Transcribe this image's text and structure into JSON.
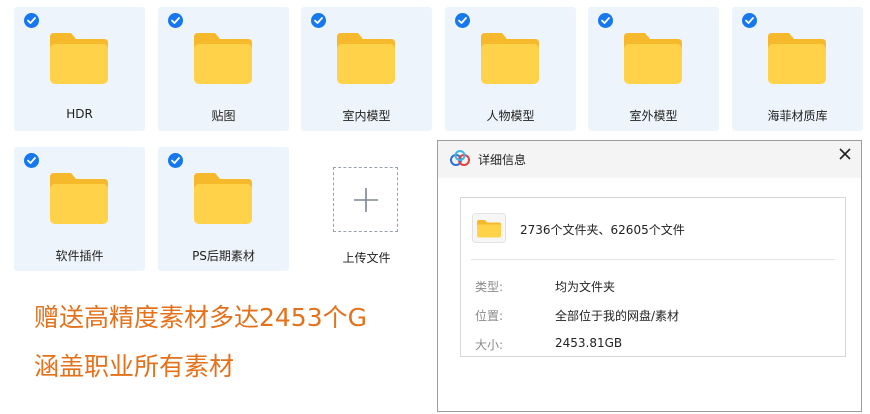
{
  "colors": {
    "tile_bg": "#eef4fb",
    "check_blue": "#1677ee",
    "folder_yellow": "#ffd24a",
    "promo_orange": "#e4711b"
  },
  "folders": [
    {
      "label": "HDR",
      "selected": true,
      "icon": "folder-icon"
    },
    {
      "label": "贴图",
      "selected": true,
      "icon": "folder-icon"
    },
    {
      "label": "室内模型",
      "selected": true,
      "icon": "folder-icon"
    },
    {
      "label": "人物模型",
      "selected": true,
      "icon": "folder-icon"
    },
    {
      "label": "室外模型",
      "selected": true,
      "icon": "folder-icon"
    },
    {
      "label": "海菲材质库",
      "selected": true,
      "icon": "folder-icon"
    },
    {
      "label": "软件插件",
      "selected": true,
      "icon": "folder-icon"
    },
    {
      "label": "PS后期素材",
      "selected": true,
      "icon": "folder-icon"
    }
  ],
  "upload": {
    "label": "上传文件",
    "icon": "plus-icon"
  },
  "promo": {
    "line1": "赠送高精度素材多达2453个G",
    "line2": "涵盖职业所有素材"
  },
  "dialog": {
    "title": "详细信息",
    "close_icon": "close-icon",
    "summary": "2736个文件夹、62605个文件",
    "rows": [
      {
        "key": "类型:",
        "value": "均为文件夹"
      },
      {
        "key": "位置:",
        "value": "全部位于我的网盘/素材"
      },
      {
        "key": "大小:",
        "value": "2453.81GB"
      }
    ]
  }
}
